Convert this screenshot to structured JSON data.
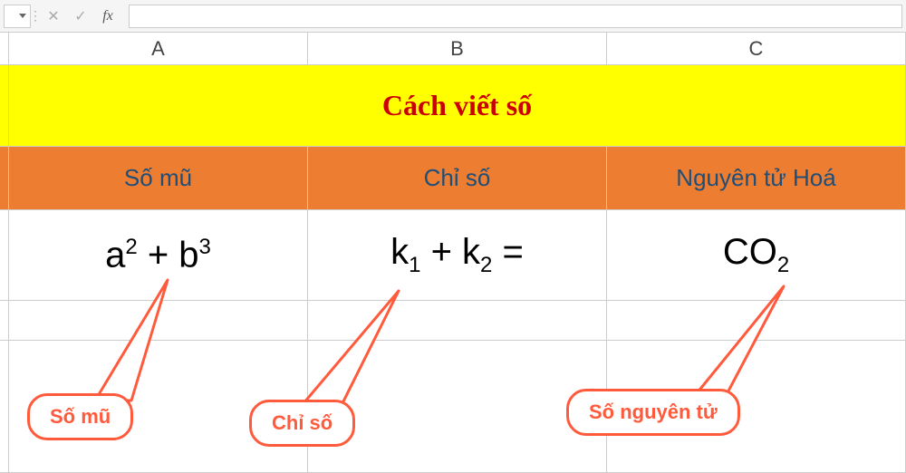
{
  "formula_bar": {
    "name_box_value": "",
    "cancel_glyph": "✕",
    "enter_glyph": "✓",
    "fx_label": "fx",
    "formula_value": ""
  },
  "columns": [
    "A",
    "B",
    "C"
  ],
  "title_row": {
    "text": "Cách viết số"
  },
  "header_row": {
    "A": "Số mũ",
    "B": "Chỉ số",
    "C": "Nguyên tử Hoá"
  },
  "data_row": {
    "A": {
      "base1": "a",
      "sup1": "2",
      "plus": " + ",
      "base2": "b",
      "sup2": "3"
    },
    "B": {
      "base1": "k",
      "sub1": "1",
      "plus": " + ",
      "base2": "k",
      "sub2": "2",
      "tail": " ="
    },
    "C": {
      "base1": "CO",
      "sub1": "2"
    }
  },
  "callouts": {
    "c1": "Số mũ",
    "c2": "Chỉ số",
    "c3": "Số nguyên tử"
  }
}
